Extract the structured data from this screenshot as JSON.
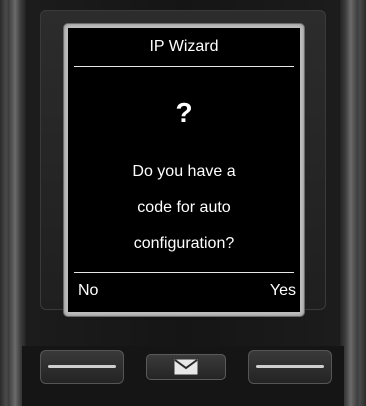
{
  "screen": {
    "title": "IP Wizard",
    "icon": "question-mark-icon",
    "icon_glyph": "?",
    "message_lines": [
      "Do you have a",
      "code for auto",
      "configuration?"
    ]
  },
  "softkeys": {
    "left": "No",
    "right": "Yes"
  },
  "hardware_keys": {
    "left": "left-softkey-button",
    "center": "message-key",
    "center_icon": "envelope-icon",
    "right": "right-softkey-button"
  }
}
